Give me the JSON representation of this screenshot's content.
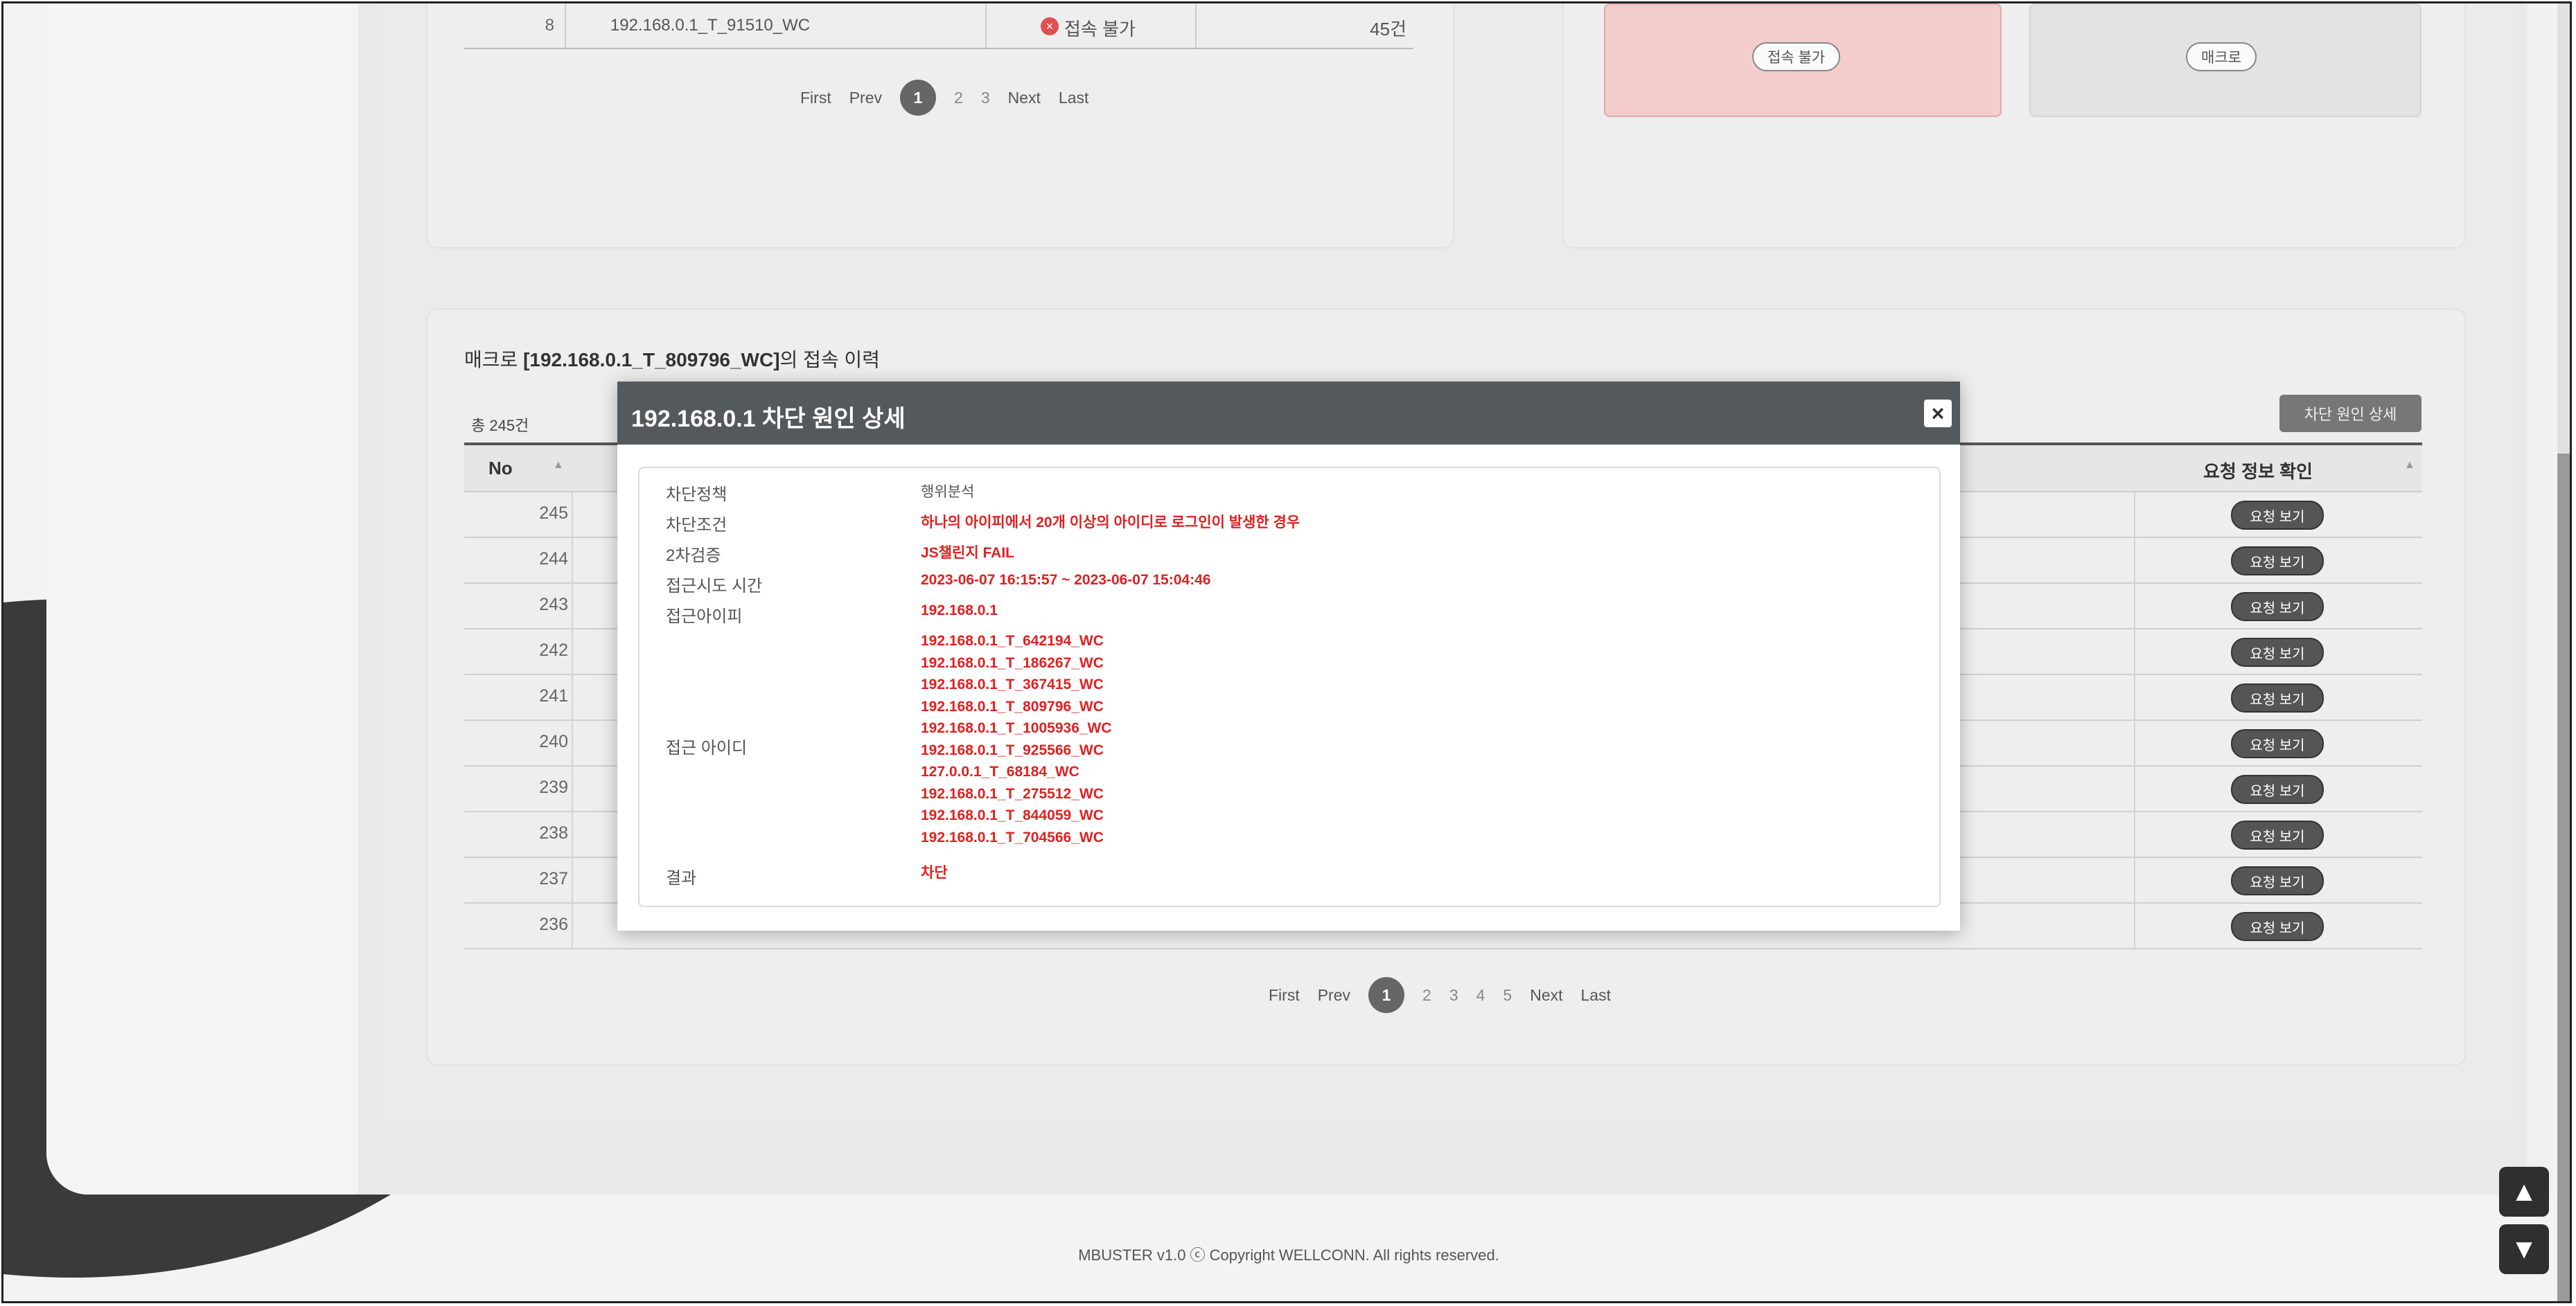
{
  "top_table": {
    "row": {
      "no": "8",
      "id": "192.168.0.1_T_91510_WC",
      "status": "접속 불가",
      "count": "45건"
    }
  },
  "top_pager": {
    "first": "First",
    "prev": "Prev",
    "pages": [
      "1",
      "2",
      "3"
    ],
    "next": "Next",
    "last": "Last"
  },
  "status_cards": {
    "blocked_label": "접속 불가",
    "macro_label": "매크로"
  },
  "history": {
    "title_prefix": "매크로 ",
    "title_id": "[192.168.0.1_T_809796_WC]",
    "title_suffix": "의 접속 이력",
    "count": "총 245건",
    "detail_button": "차단 원인 상세",
    "col_no": "No",
    "col_request": "요청 정보 확인",
    "rows": [
      "245",
      "244",
      "243",
      "242",
      "241",
      "240",
      "239",
      "238",
      "237",
      "236"
    ],
    "request_button": "요청 보기"
  },
  "bottom_pager": {
    "first": "First",
    "prev": "Prev",
    "pages": [
      "1",
      "2",
      "3",
      "4",
      "5"
    ],
    "next": "Next",
    "last": "Last"
  },
  "modal": {
    "title": "192.168.0.1 차단 원인 상세",
    "close": "×",
    "labels": {
      "policy": "차단정책",
      "condition": "차단조건",
      "second": "2차검증",
      "time": "접근시도 시간",
      "ip": "접근아이피",
      "ids": "접근 아이디",
      "result": "결과"
    },
    "values": {
      "policy": "행위분석",
      "condition": "하나의 아이피에서 20개 이상의 아이디로 로그인이 발생한 경우",
      "second": "JS챌린지 FAIL",
      "time": "2023-06-07 16:15:57 ~ 2023-06-07 15:04:46",
      "ip": "192.168.0.1",
      "ids": [
        "192.168.0.1_T_642194_WC",
        "192.168.0.1_T_186267_WC",
        "192.168.0.1_T_367415_WC",
        "192.168.0.1_T_809796_WC",
        "192.168.0.1_T_1005936_WC",
        "192.168.0.1_T_925566_WC",
        "127.0.0.1_T_68184_WC",
        "192.168.0.1_T_275512_WC",
        "192.168.0.1_T_844059_WC",
        "192.168.0.1_T_704566_WC"
      ],
      "result": "차단"
    }
  },
  "footer": "MBUSTER v1.0 ⓒ Copyright WELLCONN. All rights reserved.",
  "nav": {
    "up": "▲",
    "down": "▼"
  }
}
